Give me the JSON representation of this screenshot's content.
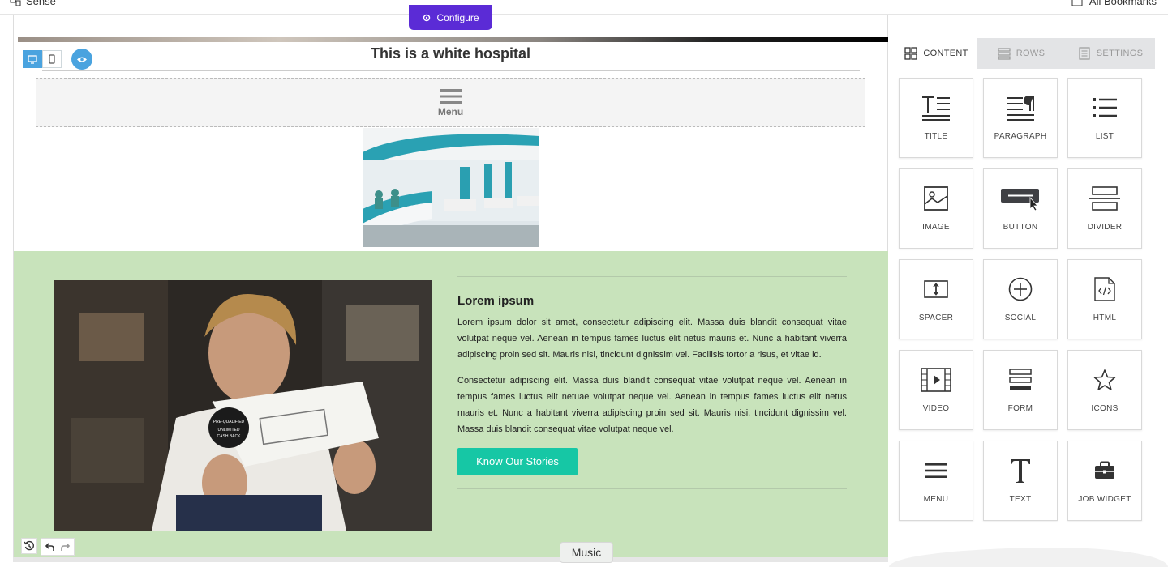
{
  "topbar": {
    "left_label": "Sense",
    "right_label": "All Bookmarks"
  },
  "configure": {
    "label": "Configure"
  },
  "page": {
    "title": "This is a white hospital",
    "menu_label": "Menu"
  },
  "section": {
    "heading": "Lorem ipsum",
    "paragraph1": "Lorem ipsum dolor sit amet, consectetur adipiscing elit. Massa duis blandit consequat vitae volutpat neque vel. Aenean in tempus fames luctus elit netus mauris et. Nunc a habitant viverra adipiscing proin sed sit. Mauris nisi, tincidunt dignissim vel. Facilisis tortor a risus, et vitae id.",
    "paragraph2": "Consectetur adipiscing elit. Massa duis blandit consequat vitae volutpat neque vel. Aenean in tempus fames luctus elit netuae volutpat neque vel. Aenean in tempus fames luctus elit netus mauris et. Nunc a habitant viverra adipiscing proin sed sit. Mauris nisi, tincidunt dignissim vel. Massa duis blandit consequat vitae volutpat neque vel.",
    "cta_label": "Know Our Stories",
    "badge_text": [
      "PRE-QUALIFIED",
      "UNLIMITED",
      "CASH BACK"
    ]
  },
  "tooltip": {
    "label": "Music"
  },
  "panel": {
    "tabs": [
      {
        "label": "CONTENT",
        "icon": "grid-icon",
        "active": true
      },
      {
        "label": "ROWS",
        "icon": "rows-icon",
        "active": false
      },
      {
        "label": "SETTINGS",
        "icon": "settings-doc-icon",
        "active": false
      }
    ],
    "blocks": [
      {
        "label": "TITLE",
        "icon": "title-icon"
      },
      {
        "label": "PARAGRAPH",
        "icon": "paragraph-icon"
      },
      {
        "label": "LIST",
        "icon": "list-icon"
      },
      {
        "label": "IMAGE",
        "icon": "image-icon"
      },
      {
        "label": "BUTTON",
        "icon": "button-icon"
      },
      {
        "label": "DIVIDER",
        "icon": "divider-icon"
      },
      {
        "label": "SPACER",
        "icon": "spacer-icon"
      },
      {
        "label": "SOCIAL",
        "icon": "social-plus-icon"
      },
      {
        "label": "HTML",
        "icon": "html-file-icon"
      },
      {
        "label": "VIDEO",
        "icon": "video-film-icon"
      },
      {
        "label": "FORM",
        "icon": "form-icon"
      },
      {
        "label": "ICONS",
        "icon": "star-icon"
      },
      {
        "label": "MENU",
        "icon": "hamburger-icon"
      },
      {
        "label": "TEXT",
        "icon": "text-t-icon"
      },
      {
        "label": "JOB WIDGET",
        "icon": "briefcase-icon"
      }
    ]
  },
  "colors": {
    "configure_bg": "#5b2bd6",
    "cta_bg": "#16c7a5",
    "row_bg": "#c8e3bb",
    "device_active": "#4aa3df"
  }
}
